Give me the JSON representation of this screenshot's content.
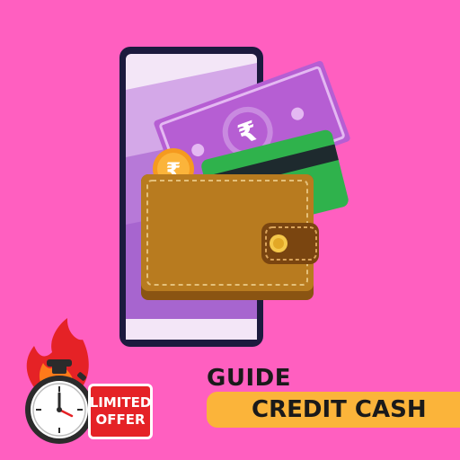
{
  "guide_title": "GUIDE",
  "cta_label": "CREDIT CASH",
  "badge": {
    "line1": "LIMITED",
    "line2": "OFFER"
  },
  "currency_symbol": "₹",
  "icons": [
    "phone-icon",
    "banknote-icon",
    "credit-card-icon",
    "coin-icon",
    "wallet-icon",
    "flame-icon",
    "stopwatch-icon"
  ],
  "colors": {
    "background": "#ff5fc0",
    "phone_frame": "#1c1a3e",
    "phone_screen": "#b779d8",
    "banknote": "#b65ed3",
    "card": "#2fb24c",
    "wallet": "#b87b1f",
    "coin": "#fbb43a",
    "banner": "#fbb43a",
    "badge": "#e52226"
  }
}
